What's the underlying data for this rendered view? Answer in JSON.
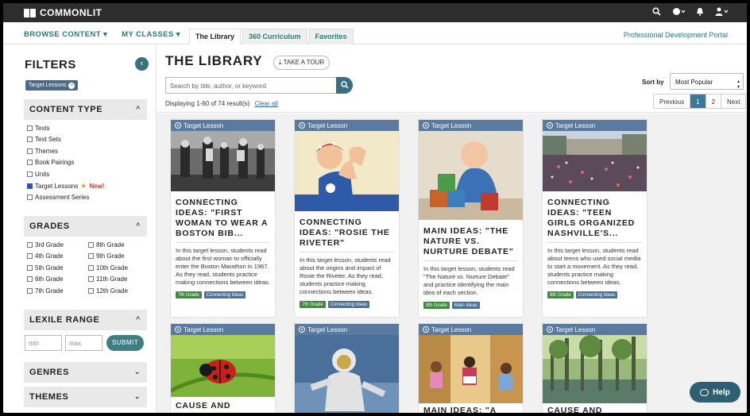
{
  "brand": {
    "name": "COMMONLIT"
  },
  "topbar_icons": [
    "search-icon",
    "globe-icon",
    "bell-icon",
    "user-icon"
  ],
  "nav": {
    "browse": "BROWSE CONTENT ▾",
    "classes": "MY CLASSES ▾",
    "tabs": [
      "The Library",
      "360 Curriculum",
      "Favorites"
    ],
    "portal": "Professional Development Portal"
  },
  "sidebar": {
    "title": "FILTERS",
    "collapse_icon": "‹",
    "chip": "Target Lessons",
    "chip_remove": "×",
    "content_type": {
      "title": "CONTENT TYPE",
      "chevron": "^",
      "options": [
        "Texts",
        "Text Sets",
        "Themes",
        "Book Pairings",
        "Units",
        "Target Lessons",
        "Assessment Series"
      ],
      "new_label": "New!",
      "star": "★"
    },
    "grades": {
      "title": "GRADES",
      "chevron": "^",
      "left": [
        "3rd Grade",
        "4th Grade",
        "5th Grade",
        "6th Grade",
        "7th Grade"
      ],
      "right": [
        "8th Grade",
        "9th Grade",
        "10th Grade",
        "11th Grade",
        "12th Grade"
      ]
    },
    "lexile": {
      "title": "LEXILE RANGE",
      "chevron": "^",
      "min_placeholder": "min",
      "max_placeholder": "max",
      "submit": "SUBMIT"
    },
    "genres": {
      "title": "GENRES",
      "chevron": "⌄"
    },
    "themes": {
      "title": "THEMES",
      "chevron": "⌄"
    }
  },
  "main": {
    "title": "THE LIBRARY",
    "tour": "⤓ TAKE A TOUR",
    "search_placeholder": "Search by title, author, or keyword",
    "search_icon": "⌕",
    "results": "Displaying 1-60 of 74 result(s)",
    "clear": "Clear all",
    "sort_label": "Sort by",
    "sort_value": "Most Popular",
    "sort_caret": "▲▼",
    "pager": [
      "Previous",
      "1",
      "2",
      "Next"
    ]
  },
  "cards": [
    {
      "badge": "Target Lesson",
      "title": "CONNECTING IDEAS: \"FIRST WOMAN TO WEAR A BOSTON BIB...",
      "desc": "In this target lesson, students read about the first woman to officially enter the Boston Marathon in 1967. As they read, students practice making connections between ideas.",
      "tags": [
        "7th Grade",
        "Connecting Ideas"
      ]
    },
    {
      "badge": "Target Lesson",
      "title": "CONNECTING IDEAS: \"ROSIE THE RIVETER\"",
      "desc": "In this target lesson, students read about the origins and impact of Rosie the Riveter. As they read, students practice making connections between ideas.",
      "tags": [
        "7th Grade",
        "Connecting Ideas"
      ]
    },
    {
      "badge": "Target Lesson",
      "title": "MAIN IDEAS: \"THE NATURE VS. NURTURE DEBATE\"",
      "desc": "In this target lesson, students read \"The Nature vs. Nurture Debate\" and practice identifying the main idea of each section.",
      "tags": [
        "8th Grade",
        "Main Ideas"
      ]
    },
    {
      "badge": "Target Lesson",
      "title": "CONNECTING IDEAS: \"TEEN GIRLS ORGANIZED NASHVILLE'S...",
      "desc": "In this target lesson, students read about teens who used social media to start a movement. As they read, students practice making connections between ideas.",
      "tags": [
        "8th Grade",
        "Connecting Ideas"
      ]
    },
    {
      "badge": "Target Lesson",
      "title": "CAUSE AND"
    },
    {
      "badge": "Target Lesson",
      "title": ""
    },
    {
      "badge": "Target Lesson",
      "title": "MAIN IDEAS: \"A"
    },
    {
      "badge": "Target Lesson",
      "title": "CAUSE AND"
    }
  ],
  "help": {
    "label": "Help"
  }
}
